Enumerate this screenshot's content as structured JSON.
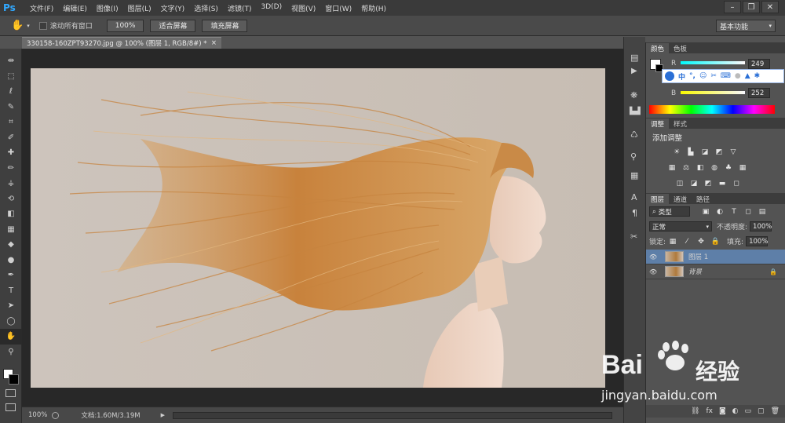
{
  "app": {
    "logo": "Ps"
  },
  "menu": [
    "文件(F)",
    "编辑(E)",
    "图像(I)",
    "图层(L)",
    "文字(Y)",
    "选择(S)",
    "滤镜(T)",
    "3D(D)",
    "视图(V)",
    "窗口(W)",
    "帮助(H)"
  ],
  "options": {
    "scroll_all_label": "滚动所有窗口",
    "zoom_value": "100%",
    "fit_screen_label": "适合屏幕",
    "fill_screen_label": "填充屏幕",
    "workspace_label": "基本功能"
  },
  "document": {
    "tab_title": "330158-160ZPT93270.jpg @ 100% (图层 1, RGB/8#) *",
    "zoom": "100%",
    "doc_size": "文档:1.60M/3.19M"
  },
  "tools": [
    "move-tool",
    "marquee-tool",
    "lasso-tool",
    "quick-select-tool",
    "crop-tool",
    "eyedropper-tool",
    "healing-tool",
    "brush-tool",
    "stamp-tool",
    "history-brush-tool",
    "eraser-tool",
    "gradient-tool",
    "blur-tool",
    "dodge-tool",
    "pen-tool",
    "type-tool",
    "path-select-tool",
    "shape-tool",
    "hand-tool",
    "zoom-tool"
  ],
  "color_panel": {
    "tabs": [
      "颜色",
      "色板"
    ],
    "r_label": "R",
    "r_value": "249",
    "b_label": "B",
    "b_value": "252",
    "foreground": "#ffffff",
    "background": "#000000"
  },
  "adjust_panel": {
    "tabs": [
      "调整",
      "样式"
    ],
    "title": "添加调整"
  },
  "layers_panel": {
    "tabs": [
      "图层",
      "通道",
      "路径"
    ],
    "filter_label": "类型",
    "blend_mode": "正常",
    "opacity_label": "不透明度:",
    "opacity_value": "100%",
    "lock_label": "锁定:",
    "fill_label": "填充:",
    "fill_value": "100%",
    "layers": [
      {
        "name": "图层 1",
        "selected": true,
        "locked": false
      },
      {
        "name": "背景",
        "selected": false,
        "locked": true
      }
    ]
  },
  "ime_toolbar": [
    "中",
    "°,",
    "☺",
    "✂",
    "⌨"
  ],
  "watermark": {
    "brand": "Bai",
    "brand2": "经验",
    "url": "jingyan.baidu.com"
  }
}
